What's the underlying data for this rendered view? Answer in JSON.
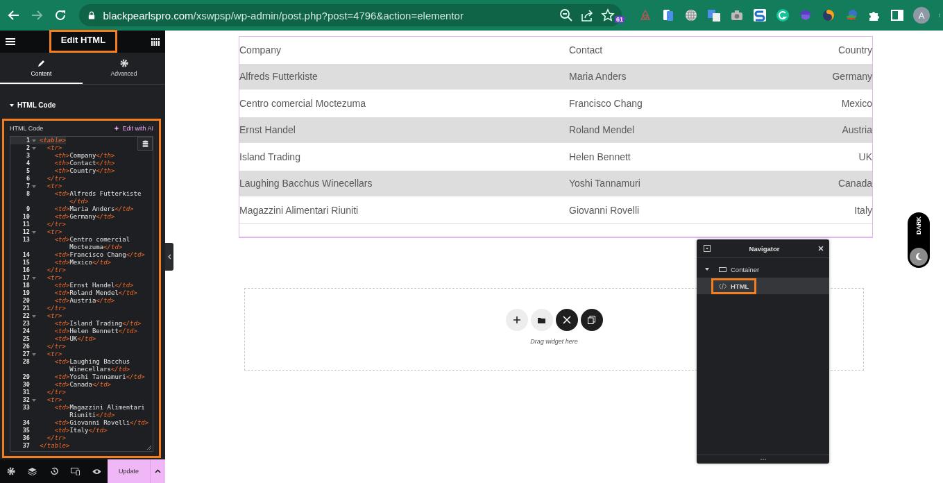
{
  "browser": {
    "url_host": "blackpearlspro.com",
    "url_path": "/xswpsp/wp-admin/post.php?post=4796&action=elementor",
    "extension_badge": "61",
    "avatar": "A"
  },
  "panel": {
    "title": "Edit HTML",
    "title_highlighted": true,
    "tabs": [
      {
        "label": "Content",
        "selected": true
      },
      {
        "label": "Advanced",
        "selected": false
      }
    ],
    "section": {
      "title": "HTML Code",
      "expanded": true
    },
    "control": {
      "label": "HTML Code",
      "ai_link": "Edit with AI",
      "highlighted": true,
      "code_lines": [
        {
          "number": "1",
          "fold": true,
          "rows": [
            "<table>"
          ]
        },
        {
          "number": "2",
          "fold": true,
          "rows": [
            "  <tr>"
          ]
        },
        {
          "number": "3",
          "fold": false,
          "rows": [
            "    <th>Company</th>"
          ]
        },
        {
          "number": "4",
          "fold": false,
          "rows": [
            "    <th>Contact</th>"
          ]
        },
        {
          "number": "5",
          "fold": false,
          "rows": [
            "    <th>Country</th>"
          ]
        },
        {
          "number": "6",
          "fold": false,
          "rows": [
            "  </tr>"
          ]
        },
        {
          "number": "7",
          "fold": true,
          "rows": [
            "  <tr>"
          ]
        },
        {
          "number": "8",
          "fold": false,
          "rows": [
            "    <td>Alfreds Futterkiste",
            "</td>"
          ]
        },
        {
          "number": "9",
          "fold": false,
          "rows": [
            "    <td>Maria Anders</td>"
          ]
        },
        {
          "number": "10",
          "fold": false,
          "rows": [
            "    <td>Germany</td>"
          ]
        },
        {
          "number": "11",
          "fold": false,
          "rows": [
            "  </tr>"
          ]
        },
        {
          "number": "12",
          "fold": true,
          "rows": [
            "  <tr>"
          ]
        },
        {
          "number": "13",
          "fold": false,
          "rows": [
            "    <td>Centro comercial",
            "Moctezuma</td>"
          ]
        },
        {
          "number": "14",
          "fold": false,
          "rows": [
            "    <td>Francisco Chang</td>"
          ]
        },
        {
          "number": "15",
          "fold": false,
          "rows": [
            "    <td>Mexico</td>"
          ]
        },
        {
          "number": "16",
          "fold": false,
          "rows": [
            "  </tr>"
          ]
        },
        {
          "number": "17",
          "fold": true,
          "rows": [
            "  <tr>"
          ]
        },
        {
          "number": "18",
          "fold": false,
          "rows": [
            "    <td>Ernst Handel</td>"
          ]
        },
        {
          "number": "19",
          "fold": false,
          "rows": [
            "    <td>Roland Mendel</td>"
          ]
        },
        {
          "number": "20",
          "fold": false,
          "rows": [
            "    <td>Austria</td>"
          ]
        },
        {
          "number": "21",
          "fold": false,
          "rows": [
            "  </tr>"
          ]
        },
        {
          "number": "22",
          "fold": true,
          "rows": [
            "  <tr>"
          ]
        },
        {
          "number": "23",
          "fold": false,
          "rows": [
            "    <td>Island Trading</td>"
          ]
        },
        {
          "number": "24",
          "fold": false,
          "rows": [
            "    <td>Helen Bennett</td>"
          ]
        },
        {
          "number": "25",
          "fold": false,
          "rows": [
            "    <td>UK</td>"
          ]
        },
        {
          "number": "26",
          "fold": false,
          "rows": [
            "  </tr>"
          ]
        },
        {
          "number": "27",
          "fold": true,
          "rows": [
            "  <tr>"
          ]
        },
        {
          "number": "28",
          "fold": false,
          "rows": [
            "    <td>Laughing Bacchus",
            "Winecellars</td>"
          ]
        },
        {
          "number": "29",
          "fold": false,
          "rows": [
            "    <td>Yoshi Tannamuri</td>"
          ]
        },
        {
          "number": "30",
          "fold": false,
          "rows": [
            "    <td>Canada</td>"
          ]
        },
        {
          "number": "31",
          "fold": false,
          "rows": [
            "  </tr>"
          ]
        },
        {
          "number": "32",
          "fold": true,
          "rows": [
            "  <tr>"
          ]
        },
        {
          "number": "33",
          "fold": false,
          "rows": [
            "    <td>Magazzini Alimentari",
            "Riuniti</td>"
          ]
        },
        {
          "number": "34",
          "fold": false,
          "rows": [
            "    <td>Giovanni Rovelli</td>"
          ]
        },
        {
          "number": "35",
          "fold": false,
          "rows": [
            "    <td>Italy</td>"
          ]
        },
        {
          "number": "36",
          "fold": false,
          "rows": [
            "  </tr>"
          ]
        },
        {
          "number": "37",
          "fold": false,
          "rows": [
            "</table>"
          ]
        }
      ]
    }
  },
  "footer": {
    "update_button": "Update"
  },
  "table": {
    "columns": [
      "Company",
      "Contact",
      "Country"
    ],
    "rows": [
      [
        "Alfreds Futterkiste",
        "Maria Anders",
        "Germany"
      ],
      [
        "Centro comercial Moctezuma",
        "Francisco Chang",
        "Mexico"
      ],
      [
        "Ernst Handel",
        "Roland Mendel",
        "Austria"
      ],
      [
        "Island Trading",
        "Helen Bennett",
        "UK"
      ],
      [
        "Laughing Bacchus Winecellars",
        "Yoshi Tannamuri",
        "Canada"
      ],
      [
        "Magazzini Alimentari Riuniti",
        "Giovanni Rovelli",
        "Italy"
      ]
    ]
  },
  "drop_zone": {
    "hint": "Drag widget here"
  },
  "navigator": {
    "title": "Navigator",
    "tree": [
      {
        "label": "Container",
        "expanded": true,
        "selected": false,
        "highlighted": false,
        "children": [
          {
            "label": "HTML",
            "selected": true,
            "highlighted": true
          }
        ]
      }
    ]
  },
  "dark_toggle": {
    "label": "DARK",
    "on": false
  }
}
